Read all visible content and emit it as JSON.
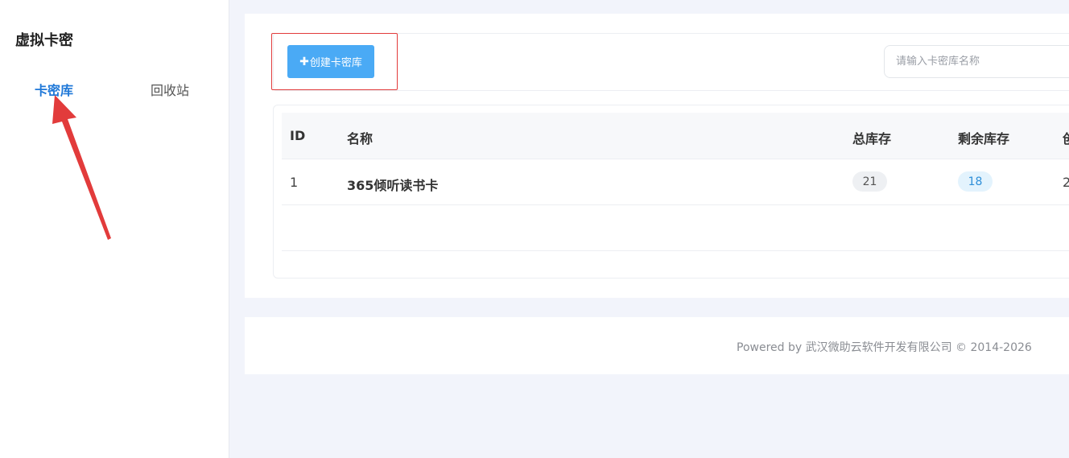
{
  "sidebar": {
    "title": "虚拟卡密",
    "tabs": [
      {
        "label": "卡密库",
        "active": true
      },
      {
        "label": "回收站",
        "active": false
      }
    ]
  },
  "toolbar": {
    "create_label": "创建卡密库",
    "plus_glyph": "✚",
    "search_placeholder": "请输入卡密库名称"
  },
  "table": {
    "headers": [
      "ID",
      "名称",
      "总库存",
      "剩余库存",
      "创"
    ],
    "rows": [
      {
        "id": "1",
        "name": "365倾听读书卡",
        "total": "21",
        "remaining": "18",
        "created": "2"
      }
    ]
  },
  "footer": {
    "text": "Powered by 武汉微助云软件开发有限公司 © 2014-2026"
  },
  "colors": {
    "accent": "#1f78d8",
    "button": "#4aaaf5",
    "annotation": "#e23b3b"
  }
}
